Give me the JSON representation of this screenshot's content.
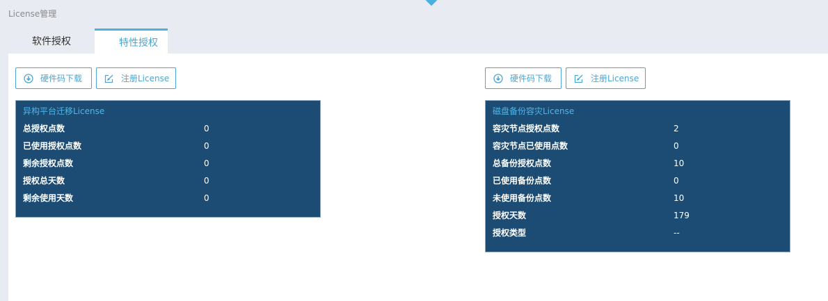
{
  "page": {
    "title": "License管理"
  },
  "tabs": [
    {
      "label": "软件授权",
      "active": false
    },
    {
      "label": "特性授权",
      "active": true
    }
  ],
  "colors": {
    "accent": "#4ab0e0",
    "card_bg": "#1c4c73",
    "card_title": "#4fb6ea",
    "page_bg": "#e8ebf2"
  },
  "panels": {
    "left": {
      "download_label": "硬件码下载",
      "register_label": "注册License",
      "card_title": "异构平台迁移License",
      "rows": [
        {
          "label": "总授权点数",
          "value": "0"
        },
        {
          "label": "已使用授权点数",
          "value": "0"
        },
        {
          "label": "剩余授权点数",
          "value": "0"
        },
        {
          "label": "授权总天数",
          "value": "0"
        },
        {
          "label": "剩余使用天数",
          "value": "0"
        }
      ]
    },
    "right": {
      "download_label": "硬件码下载",
      "register_label": "注册License",
      "card_title": "磁盘备份容灾License",
      "rows": [
        {
          "label": "容灾节点授权点数",
          "value": "2"
        },
        {
          "label": "容灾节点已使用点数",
          "value": "0"
        },
        {
          "label": "总备份授权点数",
          "value": "10"
        },
        {
          "label": "已使用备份点数",
          "value": "0"
        },
        {
          "label": "未使用备份点数",
          "value": "10"
        },
        {
          "label": "授权天数",
          "value": "179"
        },
        {
          "label": "授权类型",
          "value": "--"
        }
      ]
    }
  },
  "icons": {
    "download": "download-circle-icon",
    "register": "edit-icon"
  }
}
